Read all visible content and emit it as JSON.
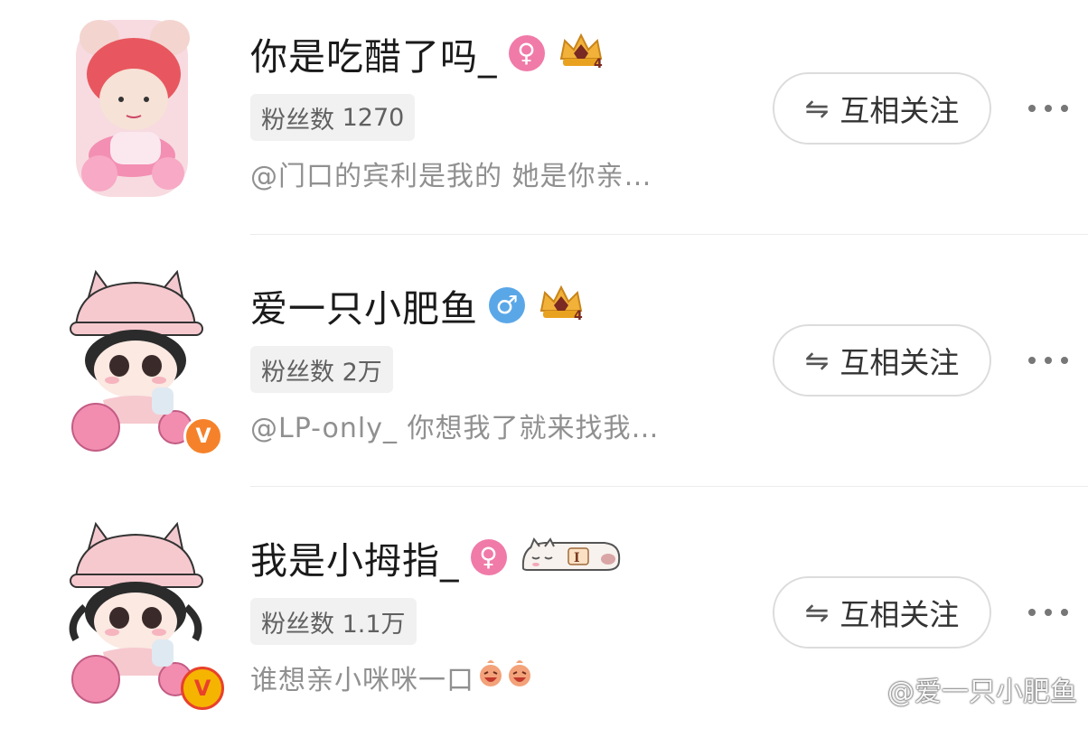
{
  "colors": {
    "female": "#f07aa8",
    "male": "#5aa7e8",
    "verified_orange": "#f5822a",
    "verified_gold": "#f5b400"
  },
  "users": [
    {
      "name": "你是吃醋了吗_",
      "gender_icon": "female-symbol",
      "gender_glyph": "♀",
      "badge": "crown-level-4",
      "badge_level": "4",
      "fans_label": "粉丝数",
      "fans_value": "1270",
      "desc": "@门口的宾利是我的 她是你亲…",
      "follow_label": "互相关注"
    },
    {
      "name": "爱一只小肥鱼",
      "gender_icon": "male-symbol",
      "gender_glyph": "♂",
      "badge": "crown-level-4",
      "badge_level": "4",
      "fans_label": "粉丝数",
      "fans_value": "2万",
      "desc": "@LP-only_ 你想我了就来找我…",
      "follow_label": "互相关注",
      "verified": "V"
    },
    {
      "name": "我是小拇指_",
      "gender_icon": "female-symbol",
      "gender_glyph": "♀",
      "badge": "sleeping-cat-badge",
      "badge_letter": "I",
      "fans_label": "粉丝数",
      "fans_value": "1.1万",
      "desc": "谁想亲小咪咪一口",
      "follow_label": "互相关注",
      "verified": "V"
    }
  ],
  "watermark": {
    "text": "@爱一只小肥鱼",
    "icon": "weibo-logo-icon"
  }
}
